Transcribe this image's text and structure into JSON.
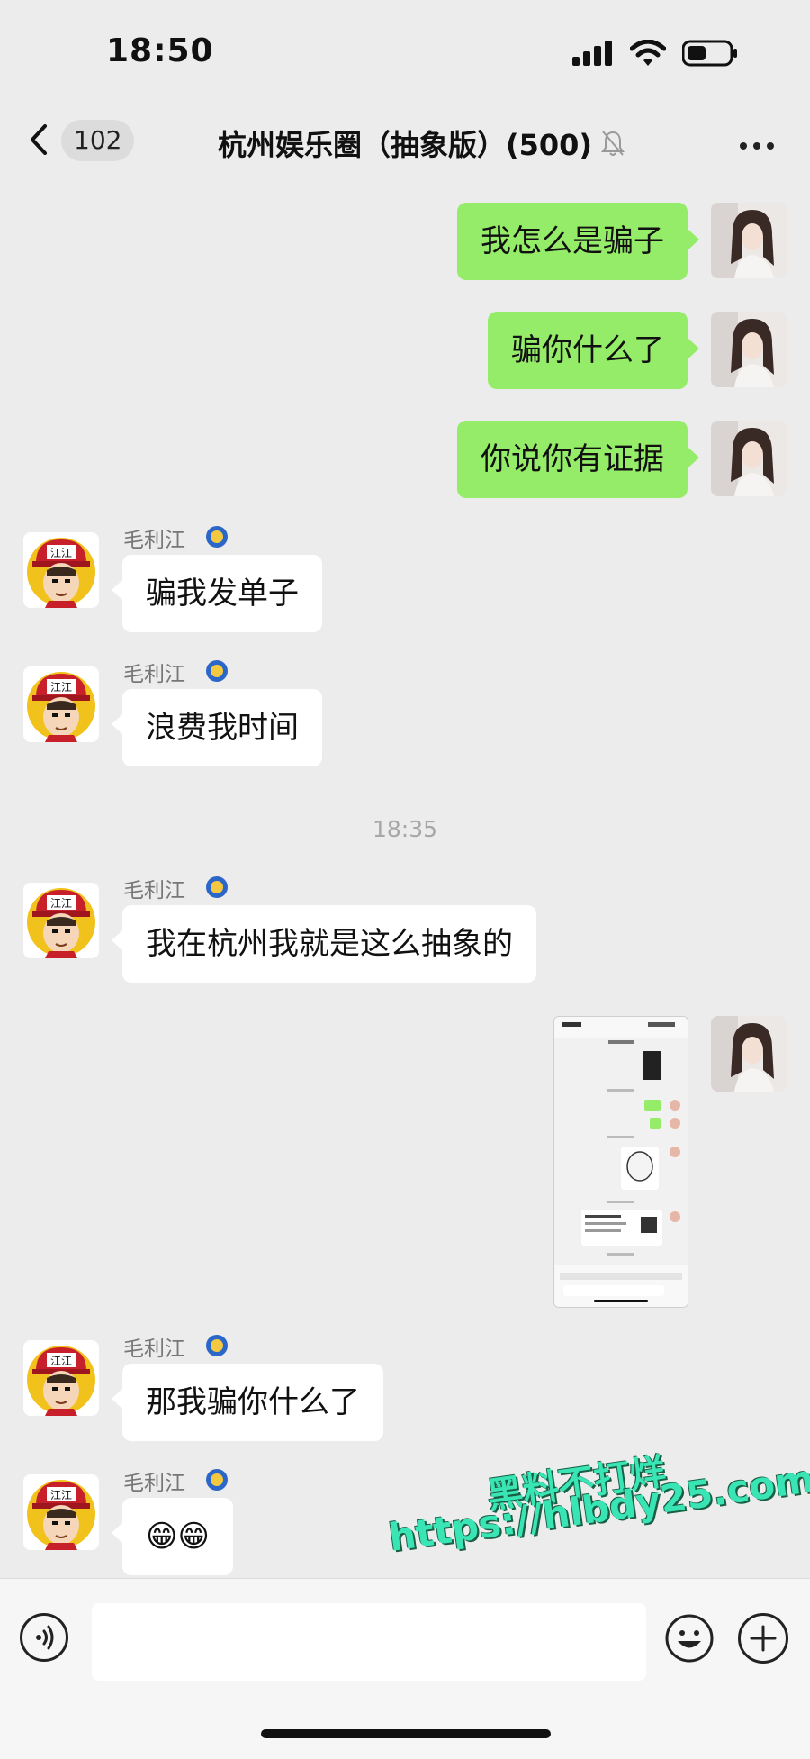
{
  "status_bar": {
    "time": "18:50"
  },
  "nav": {
    "unread_badge": "102",
    "title": "杭州娱乐圈（抽象版）(500)"
  },
  "messages": [
    {
      "side": "right",
      "text": "我怎么是骗子"
    },
    {
      "side": "right",
      "text": "骗你什么了"
    },
    {
      "side": "right",
      "text": "你说你有证据"
    },
    {
      "side": "left",
      "sender": "毛利江",
      "text": "骗我发单子"
    },
    {
      "side": "left",
      "sender": "毛利江",
      "text": "浪费我时间"
    },
    {
      "side": "left",
      "sender": "毛利江",
      "text": "我在杭州我就是这么抽象的"
    },
    {
      "side": "left",
      "sender": "毛利江",
      "text": "那我骗你什么了"
    },
    {
      "side": "left",
      "sender": "毛利江",
      "text": "😁😁"
    }
  ],
  "time_divider": "18:35",
  "avatar_badge_text": "江江",
  "watermark": {
    "line1": "黑料不打烊",
    "line2": "https://hlbdy25.com"
  },
  "colors": {
    "background": "#ececec",
    "bubble_self": "#95ec69",
    "bubble_other": "#ffffff",
    "watermark": "#39e5b4"
  },
  "icons": [
    "back-chevron-icon",
    "mute-bell-icon",
    "more-dots-icon",
    "voice-icon",
    "emoji-icon",
    "plus-icon",
    "signal-icon",
    "wifi-icon",
    "battery-icon"
  ]
}
